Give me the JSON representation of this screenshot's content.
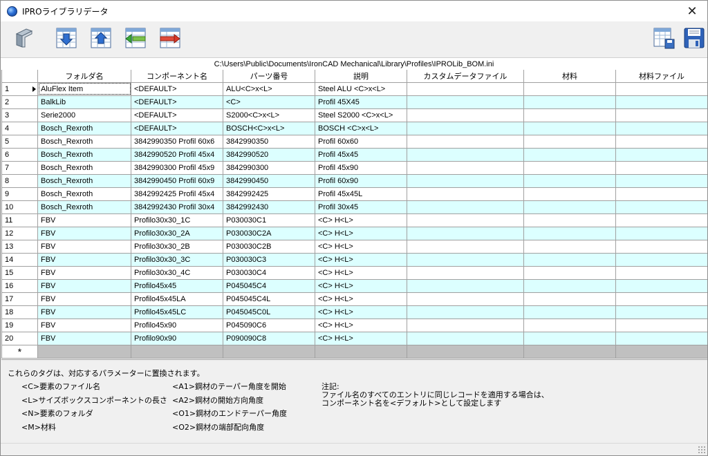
{
  "window": {
    "title": "IPROライブラリデータ"
  },
  "toolbar": {
    "left_buttons": [
      "profile-icon",
      "import-icon",
      "export-icon",
      "insert-row-icon",
      "delete-row-icon"
    ],
    "right_buttons": [
      "save-table-icon",
      "save-file-icon"
    ]
  },
  "path": "C:\\Users\\Public\\Documents\\IronCAD Mechanical\\Library\\Profiles\\IPROLib_BOM.ini",
  "grid": {
    "columns": [
      "",
      "フォルダ名",
      "コンポーネント名",
      "パーツ番号",
      "説明",
      "カスタムデータファイル",
      "材料",
      "材料ファイル"
    ],
    "rows": [
      [
        "1",
        "AluFlex Item",
        "<DEFAULT>",
        "ALU<C>x<L>",
        "Steel ALU <C>x<L>",
        "",
        "",
        ""
      ],
      [
        "2",
        "BalkLib",
        "<DEFAULT>",
        "<C>",
        "Profil 45X45",
        "",
        "",
        ""
      ],
      [
        "3",
        "Serie2000",
        "<DEFAULT>",
        "S2000<C>x<L>",
        "Steel S2000 <C>x<L>",
        "",
        "",
        ""
      ],
      [
        "4",
        "Bosch_Rexroth",
        "<DEFAULT>",
        "BOSCH<C>x<L>",
        "BOSCH <C>x<L>",
        "",
        "",
        ""
      ],
      [
        "5",
        "Bosch_Rexroth",
        "3842990350 Profil 60x6",
        "3842990350",
        "Profil 60x60",
        "",
        "",
        ""
      ],
      [
        "6",
        "Bosch_Rexroth",
        "3842990520 Profil 45x4",
        "3842990520",
        "Profil 45x45",
        "",
        "",
        ""
      ],
      [
        "7",
        "Bosch_Rexroth",
        "3842990300 Profil 45x9",
        "3842990300",
        "Profil 45x90",
        "",
        "",
        ""
      ],
      [
        "8",
        "Bosch_Rexroth",
        "3842990450 Profil 60x9",
        "3842990450",
        "Profil 60x90",
        "",
        "",
        ""
      ],
      [
        "9",
        "Bosch_Rexroth",
        "3842992425 Profil 45x4",
        "3842992425",
        "Profil 45x45L",
        "",
        "",
        ""
      ],
      [
        "10",
        "Bosch_Rexroth",
        "3842992430 Profil 30x4",
        "3842992430",
        "Profil 30x45",
        "",
        "",
        ""
      ],
      [
        "11",
        "FBV",
        "Profilo30x30_1C",
        "P030030C1",
        "<C> H<L>",
        "",
        "",
        ""
      ],
      [
        "12",
        "FBV",
        "Profilo30x30_2A",
        "P030030C2A",
        "<C> H<L>",
        "",
        "",
        ""
      ],
      [
        "13",
        "FBV",
        "Profilo30x30_2B",
        "P030030C2B",
        "<C> H<L>",
        "",
        "",
        ""
      ],
      [
        "14",
        "FBV",
        "Profilo30x30_3C",
        "P030030C3",
        "<C> H<L>",
        "",
        "",
        ""
      ],
      [
        "15",
        "FBV",
        "Profilo30x30_4C",
        "P030030C4",
        "<C> H<L>",
        "",
        "",
        ""
      ],
      [
        "16",
        "FBV",
        "Profilo45x45",
        "P045045C4",
        "<C> H<L>",
        "",
        "",
        ""
      ],
      [
        "17",
        "FBV",
        "Profilo45x45LA",
        "P045045C4L",
        "<C> H<L>",
        "",
        "",
        ""
      ],
      [
        "18",
        "FBV",
        "Profilo45x45LC",
        "P045045C0L",
        "<C> H<L>",
        "",
        "",
        ""
      ],
      [
        "19",
        "FBV",
        "Profilo45x90",
        "P045090C6",
        "<C> H<L>",
        "",
        "",
        ""
      ],
      [
        "20",
        "FBV",
        "Profilo90x90",
        "P090090C8",
        "<C> H<L>",
        "",
        "",
        ""
      ]
    ],
    "new_row_marker": "*"
  },
  "legend": {
    "intro": "これらのタグは、対応するパラメーターに置換されます。",
    "col1": [
      "<C>要素のファイル名",
      "<L>サイズボックスコンポーネントの長さ",
      "<N>要素のフォルダ",
      "<M>材料"
    ],
    "col2": [
      "<A1>鋼材のテーパー角度を開始",
      "<A2>鋼材の開始方向角度",
      "<O1>鋼材のエンドテーパー角度",
      "<O2>鋼材の端部配向角度"
    ],
    "note_title": "注記:",
    "note_line1": "ファイル名のすべてのエントリに同じレコードを適用する場合は、",
    "note_line2": "コンポーネント名を<デフォルト>として設定します"
  },
  "colors": {
    "alt_row": "#dcffff",
    "new_row": "#c0c0c0",
    "grid_line": "#a0a0a0"
  }
}
